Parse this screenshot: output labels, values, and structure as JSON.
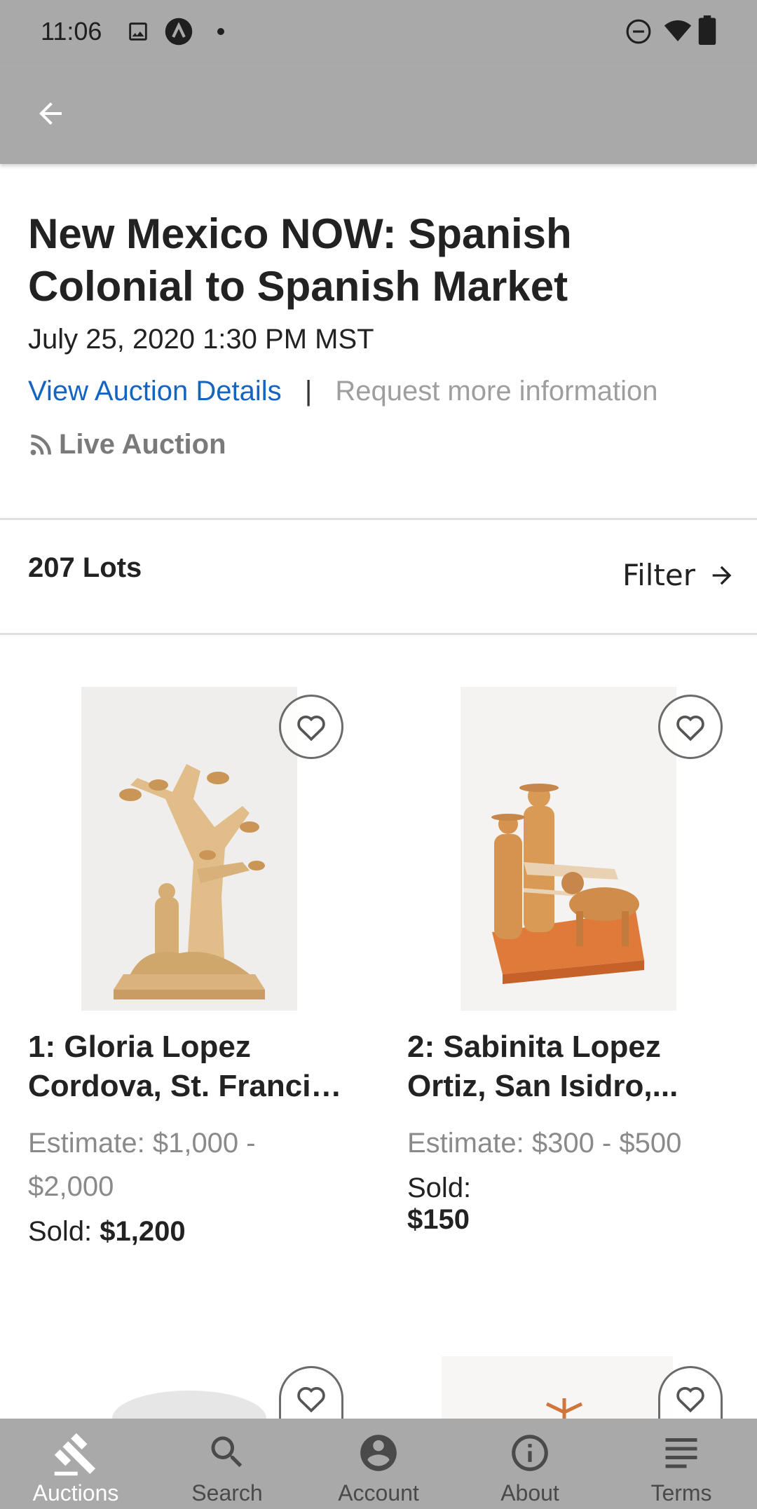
{
  "status_bar": {
    "time": "11:06"
  },
  "auction": {
    "title_line1": "New Mexico NOW: Spanish",
    "title_line2": "Colonial to Spanish Market",
    "date": "July 25, 2020 1:30 PM MST",
    "view_details_label": "View Auction Details",
    "separator": "|",
    "request_info_label": "Request more information",
    "live_label": "Live Auction"
  },
  "lots_bar": {
    "count_label": "207 Lots",
    "filter_label": "Filter"
  },
  "lots": [
    {
      "title_line1": "1: Gloria Lopez",
      "title_line2": "Cordova, St. Francis...",
      "estimate_line1": "Estimate: $1,000 -",
      "estimate_line2": "$2,000",
      "sold_label": "Sold:",
      "sold_value": "$1,200"
    },
    {
      "title_line1": "2: Sabinita Lopez",
      "title_line2": "Ortiz, San Isidro,...",
      "estimate_line1": "Estimate: $300 - $500",
      "sold_label": "Sold:",
      "sold_value": "$150"
    }
  ],
  "bottom_nav": [
    {
      "label": "Auctions",
      "icon": "gavel-icon",
      "active": true
    },
    {
      "label": "Search",
      "icon": "search-icon"
    },
    {
      "label": "Account",
      "icon": "account-icon"
    },
    {
      "label": "About",
      "icon": "info-icon"
    },
    {
      "label": "Terms",
      "icon": "terms-icon"
    }
  ],
  "colors": {
    "bar": "#a9a9a9",
    "link": "#1565c0",
    "muted": "#9e9e9e"
  }
}
